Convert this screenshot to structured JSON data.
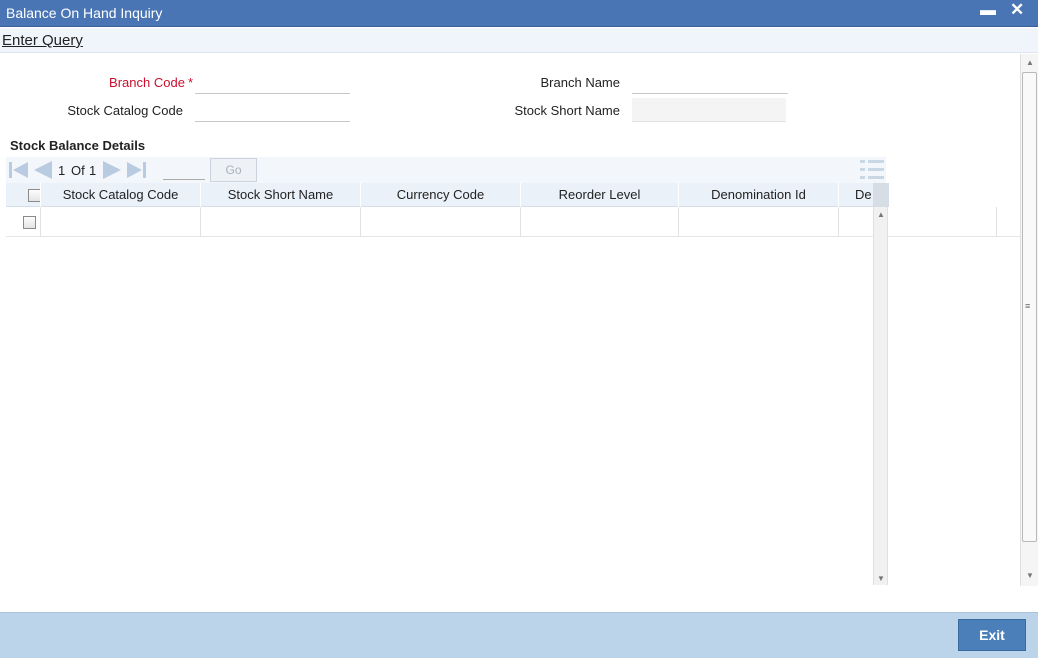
{
  "window": {
    "title": "Balance On Hand Inquiry",
    "minimize_glyph": "▬",
    "close_glyph": "✕"
  },
  "menu": {
    "enter_query": "Enter Query"
  },
  "form": {
    "branch_code_label": "Branch Code",
    "required_marker": "*",
    "branch_name_label": "Branch Name",
    "stock_catalog_code_label": "Stock Catalog Code",
    "stock_short_name_label": "Stock Short Name",
    "branch_code_value": "",
    "branch_name_value": "",
    "stock_catalog_code_value": "",
    "stock_short_name_value": ""
  },
  "section": {
    "title": "Stock Balance Details"
  },
  "pager": {
    "current": "1",
    "of_label": "Of",
    "total": "1",
    "go_label": "Go"
  },
  "grid": {
    "columns": [
      "Stock Catalog Code",
      "Stock Short Name",
      "Currency Code",
      "Reorder Level",
      "Denomination Id",
      "De"
    ]
  },
  "footer": {
    "exit_label": "Exit"
  },
  "colors": {
    "titlebar": "#4a75b5",
    "required": "#c8102e",
    "footer": "#bcd4ea",
    "exit_button": "#4b7fba",
    "pager_nav": "#b8cbe0"
  },
  "icons": [
    "minimize-icon",
    "close-icon",
    "first-page-icon",
    "previous-page-icon",
    "next-page-icon",
    "last-page-icon",
    "list-view-icon"
  ]
}
